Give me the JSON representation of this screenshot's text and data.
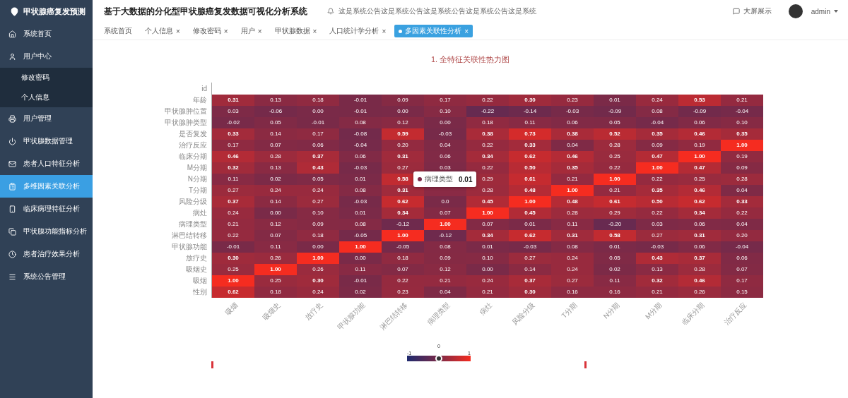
{
  "sidebar": {
    "logo": "甲状腺癌复发预测",
    "items": [
      {
        "label": "系统首页",
        "selected": false
      },
      {
        "label": "用户中心",
        "selected": false,
        "children": [
          {
            "label": "修改密码",
            "selected": false
          },
          {
            "label": "个人信息",
            "selected": false
          }
        ]
      },
      {
        "label": "用户管理",
        "selected": false
      },
      {
        "label": "甲状腺数据管理",
        "selected": false
      },
      {
        "label": "患者人口特征分析",
        "selected": false
      },
      {
        "label": "多维因素关联分析",
        "selected": true
      },
      {
        "label": "临床病理特征分析",
        "selected": false
      },
      {
        "label": "甲状腺功能指标分析",
        "selected": false
      },
      {
        "label": "患者治疗效果分析",
        "selected": false
      },
      {
        "label": "系统公告管理",
        "selected": false
      }
    ]
  },
  "header": {
    "title": "基于大数据的分化型甲状腺癌复发数据可视化分析系统",
    "notice": "这是系统公告这是系统公告这是系统公告这是系统公告这是系统",
    "screen_button": "大屏展示",
    "user": "admin"
  },
  "tabs": [
    {
      "label": "系统首页",
      "selected": false
    },
    {
      "label": "个人信息",
      "selected": false,
      "close": "×"
    },
    {
      "label": "修改密码",
      "selected": false,
      "close": "×"
    },
    {
      "label": "用户",
      "selected": false,
      "close": "×"
    },
    {
      "label": "甲状腺数据",
      "selected": false,
      "close": "×"
    },
    {
      "label": "人口统计学分析",
      "selected": false,
      "close": "×"
    },
    {
      "label": "多因素关联性分析",
      "selected": true,
      "close": "×"
    }
  ],
  "heatmap": {
    "title": "1. 全特征关联性热力图",
    "x_labels": [
      "吸烟",
      "吸烟史",
      "放疗史",
      "甲状腺功能",
      "淋巴结转移",
      "病理类型",
      "病灶",
      "风险分级",
      "T分期",
      "N分期",
      "M分期",
      "临床分期",
      "治疗反应"
    ],
    "rows": [
      {
        "label": "id",
        "values": []
      },
      {
        "label": "年龄",
        "values": [
          "0.31",
          "0.13",
          "0.18",
          "-0.01",
          "0.09",
          "0.17",
          "0.22",
          "0.30",
          "0.23",
          "0.01",
          "0.24",
          "0.53",
          "0.21"
        ]
      },
      {
        "label": "甲状腺肿位置",
        "values": [
          "0.03",
          "-0.06",
          "0.00",
          "-0.01",
          "0.00",
          "0.10",
          "-0.22",
          "-0.14",
          "-0.03",
          "-0.09",
          "0.08",
          "-0.09",
          "-0.04"
        ]
      },
      {
        "label": "甲状腺肿类型",
        "values": [
          "-0.02",
          "0.05",
          "-0.01",
          "0.08",
          "0.12",
          "0.00",
          "0.18",
          "0.11",
          "0.06",
          "0.05",
          "-0.04",
          "0.06",
          "0.10"
        ]
      },
      {
        "label": "是否复发",
        "values": [
          "0.33",
          "0.14",
          "0.17",
          "-0.08",
          "0.59",
          "-0.03",
          "0.38",
          "0.73",
          "0.38",
          "0.52",
          "0.35",
          "0.46",
          "0.35"
        ]
      },
      {
        "label": "治疗反应",
        "values": [
          "0.17",
          "0.07",
          "0.06",
          "-0.04",
          "0.20",
          "0.04",
          "0.22",
          "0.33",
          "0.04",
          "0.28",
          "0.09",
          "0.19",
          "1.00"
        ]
      },
      {
        "label": "临床分期",
        "values": [
          "0.46",
          "0.28",
          "0.37",
          "0.06",
          "0.31",
          "0.06",
          "0.34",
          "0.62",
          "0.46",
          "0.25",
          "0.47",
          "1.00",
          "0.19"
        ]
      },
      {
        "label": "M分期",
        "values": [
          "0.32",
          "0.13",
          "0.43",
          "-0.03",
          "0.27",
          "0.03",
          "0.22",
          "0.50",
          "0.35",
          "0.22",
          "1.00",
          "0.47",
          "0.09"
        ]
      },
      {
        "label": "N分期",
        "values": [
          "0.11",
          "0.02",
          "0.05",
          "0.01",
          "0.58",
          {
            "covered": true
          },
          "0.29",
          "0.61",
          "0.21",
          "1.00",
          "0.22",
          "0.25",
          "0.28"
        ]
      },
      {
        "label": "T分期",
        "values": [
          "0.27",
          "0.24",
          "0.24",
          "0.08",
          "0.31",
          {
            "covered": true
          },
          "0.28",
          "0.48",
          "1.00",
          "0.21",
          "0.35",
          "0.46",
          "0.04"
        ]
      },
      {
        "label": "风险分级",
        "values": [
          "0.37",
          "0.14",
          "0.27",
          "-0.03",
          "0.62",
          "0.0",
          "0.45",
          "1.00",
          "0.48",
          "0.61",
          "0.50",
          "0.62",
          "0.33"
        ]
      },
      {
        "label": "病灶",
        "values": [
          "0.24",
          "0.00",
          "0.10",
          "0.01",
          "0.34",
          "0.07",
          "1.00",
          "0.45",
          "0.28",
          "0.29",
          "0.22",
          "0.34",
          "0.22"
        ]
      },
      {
        "label": "病理类型",
        "values": [
          "0.21",
          "0.12",
          "0.09",
          "0.08",
          "-0.12",
          "1.00",
          "0.07",
          "0.01",
          "0.11",
          "-0.20",
          "0.03",
          "0.06",
          "0.04"
        ]
      },
      {
        "label": "淋巴结转移",
        "values": [
          "0.22",
          "0.07",
          "0.18",
          "-0.05",
          "1.00",
          "-0.12",
          "0.34",
          "0.62",
          "0.31",
          "0.58",
          "0.27",
          "0.31",
          "0.20"
        ]
      },
      {
        "label": "甲状腺功能",
        "values": [
          "-0.01",
          "0.11",
          "0.00",
          "1.00",
          "-0.05",
          "0.08",
          "0.01",
          "-0.03",
          "0.08",
          "0.01",
          "-0.03",
          "0.06",
          "-0.04"
        ]
      },
      {
        "label": "放疗史",
        "values": [
          "0.30",
          "0.26",
          "1.00",
          "0.00",
          "0.18",
          "0.09",
          "0.10",
          "0.27",
          "0.24",
          "0.05",
          "0.43",
          "0.37",
          "0.06"
        ]
      },
      {
        "label": "吸烟史",
        "values": [
          "0.25",
          "1.00",
          "0.26",
          "0.11",
          "0.07",
          "0.12",
          "0.00",
          "0.14",
          "0.24",
          "0.02",
          "0.13",
          "0.28",
          "0.07"
        ]
      },
      {
        "label": "吸烟",
        "values": [
          "1.00",
          "0.25",
          "0.30",
          "-0.01",
          "0.22",
          "0.21",
          "0.24",
          "0.37",
          "0.27",
          "0.11",
          "0.32",
          "0.46",
          "0.17"
        ]
      },
      {
        "label": "性别",
        "values": [
          "0.62",
          "0.18",
          "0.24",
          "0.02",
          "0.23",
          "0.04",
          "0.21",
          "0.30",
          "0.16",
          "0.16",
          "0.21",
          "0.26",
          "0.15"
        ]
      }
    ],
    "tooltip": {
      "name": "病理类型",
      "value": "0.01"
    },
    "legend": {
      "min": "-1",
      "mid": "0",
      "max": "1"
    }
  }
}
